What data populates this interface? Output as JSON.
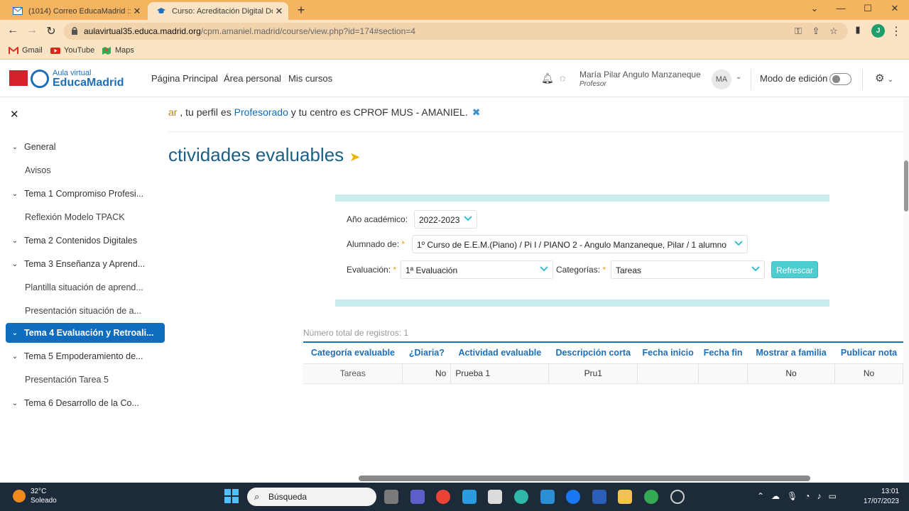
{
  "browser": {
    "tabs": [
      {
        "title": "(1014) Correo EducaMadrid :: Entr...",
        "active": false
      },
      {
        "title": "Curso: Acreditación Digital Docen...",
        "active": true
      }
    ],
    "url_domain": "aulavirtual35.educa.madrid.org",
    "url_path": "/cpm.amaniel.madrid/course/view.php?id=174#section=4",
    "profile_initial": "J",
    "bookmarks": [
      "Gmail",
      "YouTube",
      "Maps"
    ]
  },
  "header": {
    "logo_small": "Aula virtual",
    "logo_big": "EducaMadrid",
    "nav": [
      "Página Principal",
      "Área personal",
      "Mis cursos"
    ],
    "user_name": "María Pilar Angulo Manzaneque",
    "user_role": "Profesor",
    "avatar_initials": "MA",
    "edit_mode_label": "Modo de edición",
    "edit_mode_on": false
  },
  "sidebar": {
    "items": [
      {
        "label": "General",
        "type": "section"
      },
      {
        "label": "Avisos",
        "type": "sub"
      },
      {
        "label": "Tema 1 Compromiso Profesi...",
        "type": "section"
      },
      {
        "label": "Reflexión Modelo TPACK",
        "type": "sub"
      },
      {
        "label": "Tema 2 Contenidos Digitales",
        "type": "section"
      },
      {
        "label": "Tema 3 Enseñanza y Aprend...",
        "type": "section"
      },
      {
        "label": "Plantilla situación de aprend...",
        "type": "sub"
      },
      {
        "label": "Presentación situación de a...",
        "type": "sub"
      },
      {
        "label": "Tema 4 Evaluación y Retroali...",
        "type": "section",
        "active": true
      },
      {
        "label": "Tema 5 Empoderamiento de...",
        "type": "section"
      },
      {
        "label": "Presentación Tarea 5",
        "type": "sub"
      },
      {
        "label": "Tema 6 Desarrollo de la Co...",
        "type": "section"
      }
    ]
  },
  "notice": {
    "lead": "ar",
    "text1": " , tu perfil es ",
    "profile": "Profesorado",
    "text2": " y tu centro es CPROF MUS - AMANIEL.",
    "close": "✖"
  },
  "section_title": "ctividades evaluables",
  "filters": {
    "year_label": "Año académico:",
    "year_value": "2022-2023",
    "students_label": "Alumnado de:",
    "students_value": "1º Curso de E.E.M.(Piano) / Pi I / PIANO 2 - Angulo Manzaneque, Pilar / 1 alumno",
    "eval_label": "Evaluación:",
    "eval_value": "1ª Evaluación",
    "cat_label": "Categorías:",
    "cat_value": "Tareas",
    "required_mark": "*",
    "refresh_label": "Refrescar"
  },
  "table": {
    "total": "Número total de registros: 1",
    "headers": [
      "Categoría evaluable",
      "¿Diaria?",
      "Actividad evaluable",
      "Descripción corta",
      "Fecha inicio",
      "Fecha fin",
      "Mostrar a familia",
      "Publicar nota"
    ],
    "rows": [
      [
        "Tareas",
        "No",
        "Prueba 1",
        "Pru1",
        "",
        "",
        "No",
        "No"
      ]
    ]
  },
  "taskbar": {
    "temperature": "32°C",
    "weather": "Soleado",
    "search": "Búsqueda",
    "time": "13:01",
    "date": "17/07/2023"
  },
  "colors": {
    "chrome_tabbar": "#f5b460",
    "chrome_toolbar": "#fbe4c4",
    "accent": "#0f6cbf",
    "teal": "#4ecdd1"
  }
}
